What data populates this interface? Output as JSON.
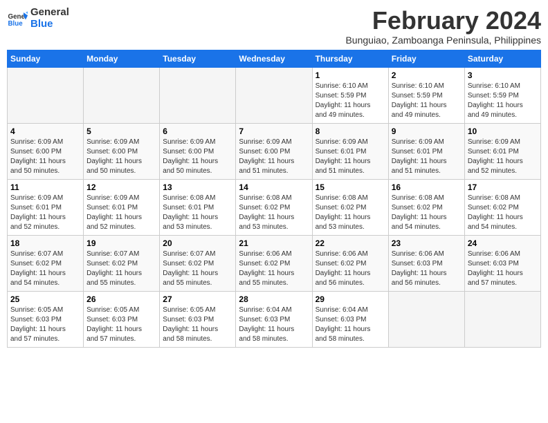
{
  "logo": {
    "line1": "General",
    "line2": "Blue"
  },
  "title": "February 2024",
  "subtitle": "Bunguiao, Zamboanga Peninsula, Philippines",
  "days_of_week": [
    "Sunday",
    "Monday",
    "Tuesday",
    "Wednesday",
    "Thursday",
    "Friday",
    "Saturday"
  ],
  "weeks": [
    [
      {
        "day": "",
        "info": ""
      },
      {
        "day": "",
        "info": ""
      },
      {
        "day": "",
        "info": ""
      },
      {
        "day": "",
        "info": ""
      },
      {
        "day": "1",
        "info": "Sunrise: 6:10 AM\nSunset: 5:59 PM\nDaylight: 11 hours\nand 49 minutes."
      },
      {
        "day": "2",
        "info": "Sunrise: 6:10 AM\nSunset: 5:59 PM\nDaylight: 11 hours\nand 49 minutes."
      },
      {
        "day": "3",
        "info": "Sunrise: 6:10 AM\nSunset: 5:59 PM\nDaylight: 11 hours\nand 49 minutes."
      }
    ],
    [
      {
        "day": "4",
        "info": "Sunrise: 6:09 AM\nSunset: 6:00 PM\nDaylight: 11 hours\nand 50 minutes."
      },
      {
        "day": "5",
        "info": "Sunrise: 6:09 AM\nSunset: 6:00 PM\nDaylight: 11 hours\nand 50 minutes."
      },
      {
        "day": "6",
        "info": "Sunrise: 6:09 AM\nSunset: 6:00 PM\nDaylight: 11 hours\nand 50 minutes."
      },
      {
        "day": "7",
        "info": "Sunrise: 6:09 AM\nSunset: 6:00 PM\nDaylight: 11 hours\nand 51 minutes."
      },
      {
        "day": "8",
        "info": "Sunrise: 6:09 AM\nSunset: 6:01 PM\nDaylight: 11 hours\nand 51 minutes."
      },
      {
        "day": "9",
        "info": "Sunrise: 6:09 AM\nSunset: 6:01 PM\nDaylight: 11 hours\nand 51 minutes."
      },
      {
        "day": "10",
        "info": "Sunrise: 6:09 AM\nSunset: 6:01 PM\nDaylight: 11 hours\nand 52 minutes."
      }
    ],
    [
      {
        "day": "11",
        "info": "Sunrise: 6:09 AM\nSunset: 6:01 PM\nDaylight: 11 hours\nand 52 minutes."
      },
      {
        "day": "12",
        "info": "Sunrise: 6:09 AM\nSunset: 6:01 PM\nDaylight: 11 hours\nand 52 minutes."
      },
      {
        "day": "13",
        "info": "Sunrise: 6:08 AM\nSunset: 6:01 PM\nDaylight: 11 hours\nand 53 minutes."
      },
      {
        "day": "14",
        "info": "Sunrise: 6:08 AM\nSunset: 6:02 PM\nDaylight: 11 hours\nand 53 minutes."
      },
      {
        "day": "15",
        "info": "Sunrise: 6:08 AM\nSunset: 6:02 PM\nDaylight: 11 hours\nand 53 minutes."
      },
      {
        "day": "16",
        "info": "Sunrise: 6:08 AM\nSunset: 6:02 PM\nDaylight: 11 hours\nand 54 minutes."
      },
      {
        "day": "17",
        "info": "Sunrise: 6:08 AM\nSunset: 6:02 PM\nDaylight: 11 hours\nand 54 minutes."
      }
    ],
    [
      {
        "day": "18",
        "info": "Sunrise: 6:07 AM\nSunset: 6:02 PM\nDaylight: 11 hours\nand 54 minutes."
      },
      {
        "day": "19",
        "info": "Sunrise: 6:07 AM\nSunset: 6:02 PM\nDaylight: 11 hours\nand 55 minutes."
      },
      {
        "day": "20",
        "info": "Sunrise: 6:07 AM\nSunset: 6:02 PM\nDaylight: 11 hours\nand 55 minutes."
      },
      {
        "day": "21",
        "info": "Sunrise: 6:06 AM\nSunset: 6:02 PM\nDaylight: 11 hours\nand 55 minutes."
      },
      {
        "day": "22",
        "info": "Sunrise: 6:06 AM\nSunset: 6:02 PM\nDaylight: 11 hours\nand 56 minutes."
      },
      {
        "day": "23",
        "info": "Sunrise: 6:06 AM\nSunset: 6:03 PM\nDaylight: 11 hours\nand 56 minutes."
      },
      {
        "day": "24",
        "info": "Sunrise: 6:06 AM\nSunset: 6:03 PM\nDaylight: 11 hours\nand 57 minutes."
      }
    ],
    [
      {
        "day": "25",
        "info": "Sunrise: 6:05 AM\nSunset: 6:03 PM\nDaylight: 11 hours\nand 57 minutes."
      },
      {
        "day": "26",
        "info": "Sunrise: 6:05 AM\nSunset: 6:03 PM\nDaylight: 11 hours\nand 57 minutes."
      },
      {
        "day": "27",
        "info": "Sunrise: 6:05 AM\nSunset: 6:03 PM\nDaylight: 11 hours\nand 58 minutes."
      },
      {
        "day": "28",
        "info": "Sunrise: 6:04 AM\nSunset: 6:03 PM\nDaylight: 11 hours\nand 58 minutes."
      },
      {
        "day": "29",
        "info": "Sunrise: 6:04 AM\nSunset: 6:03 PM\nDaylight: 11 hours\nand 58 minutes."
      },
      {
        "day": "",
        "info": ""
      },
      {
        "day": "",
        "info": ""
      }
    ]
  ]
}
